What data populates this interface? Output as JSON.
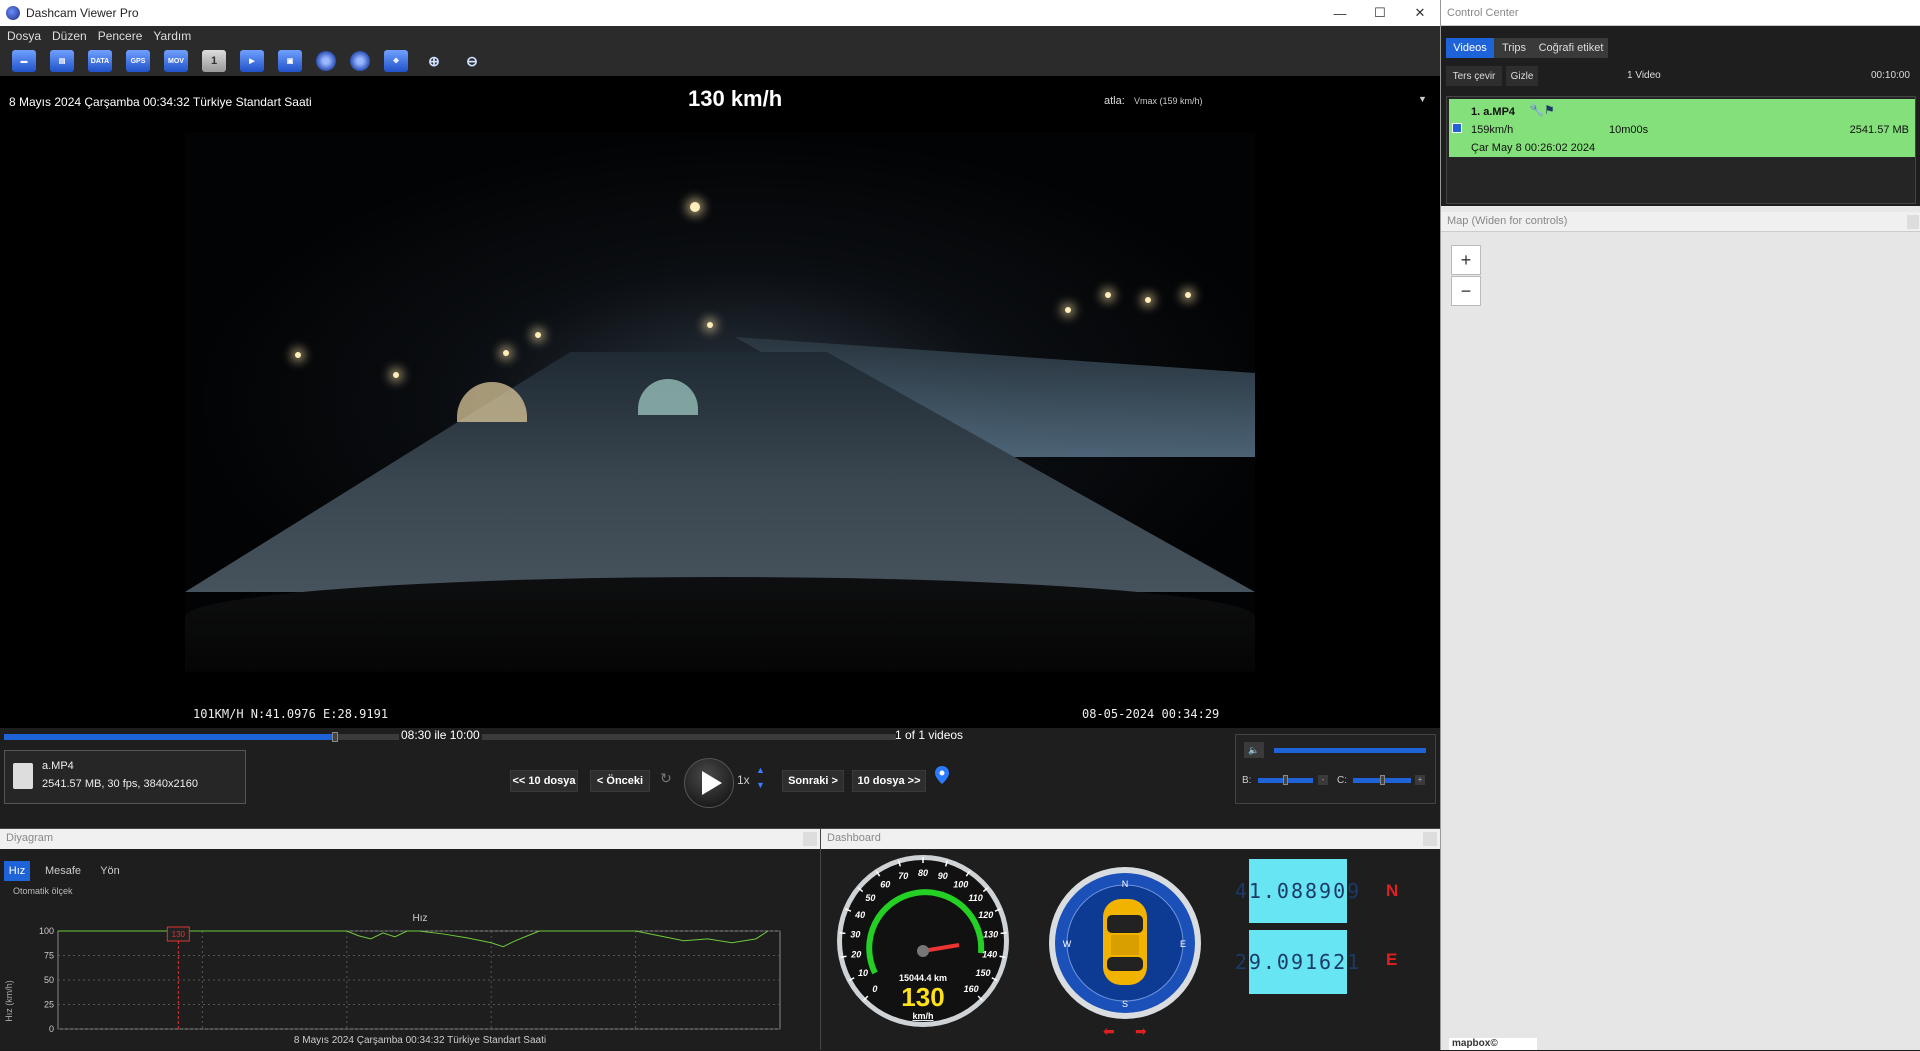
{
  "window": {
    "title": "Dashcam Viewer Pro",
    "minimize": "—",
    "maximize": "☐",
    "close": "✕"
  },
  "menu": [
    "Dosya",
    "Düzen",
    "Pencere",
    "Yardım"
  ],
  "toolbar": {
    "buttons": [
      "open-folder",
      "open-files",
      "DATA",
      "GPS",
      "MOV",
      "1",
      "export-clip",
      "lock",
      "previous-frame",
      "next-frame",
      "fullscreen",
      "zoom-in",
      "zoom-out"
    ],
    "data_label": "DATA",
    "gps_label": "GPS",
    "mov_label": "MOV",
    "one_label": "1"
  },
  "video": {
    "datetime": "8 Mayıs 2024 Çarşamba 00:34:32 Türkiye Standart Saati",
    "speed": "130 km/h",
    "skip_label": "atla:",
    "skip_value": "Vmax (159 km/h)",
    "overlay_gps": "101KM/H N:41.0976 E:28.9191",
    "overlay_time": "08-05-2024 00:34:29"
  },
  "playback": {
    "progress": 0.37,
    "segment_label": "08:30 ile 10:00",
    "videos_count": "1 of 1 videos",
    "file_name": "a.MP4",
    "file_meta": "2541.57 MB, 30 fps, 3840x2160",
    "back10": "<< 10 dosya",
    "prev": "< Önceki",
    "next": "Sonraki >",
    "fwd10": "10 dosya >>",
    "rate": "1x",
    "brightness_label": "B:",
    "contrast_label": "C:",
    "minus": "-",
    "plus": "+"
  },
  "diagram": {
    "title": "Diyagram",
    "tabs": [
      "Hız",
      "Mesafe",
      "Yön"
    ],
    "auto_scale": "Otomatik ölçek",
    "chart_title": "Hız",
    "y_label": "Hız (km/h)",
    "x_label": "8 Mayıs 2024 Çarşamba 00:34:32 Türkiye Standart Saati",
    "marker_value": "130"
  },
  "chart_data": {
    "type": "line",
    "title": "Hız",
    "xlabel": "8 Mayıs 2024 Çarşamba 00:34:32 Türkiye Standart Saati",
    "ylabel": "Hız (km/h)",
    "ylim": [
      0,
      100
    ],
    "yticks": [
      0,
      25,
      50,
      75,
      100
    ],
    "grid": true,
    "series": [
      {
        "color": "#6ec93a",
        "x": [
          0,
          40,
          80,
          120,
          160,
          200,
          240,
          250,
          260,
          270,
          280,
          290,
          300,
          320,
          340,
          360,
          370,
          380,
          390,
          400,
          480,
          500,
          520,
          540,
          560,
          580,
          590
        ],
        "values": [
          100,
          100,
          100,
          100,
          100,
          100,
          100,
          95,
          92,
          98,
          94,
          100,
          100,
          97,
          93,
          88,
          84,
          90,
          95,
          100,
          100,
          95,
          90,
          92,
          88,
          92,
          100
        ]
      }
    ],
    "marker": {
      "x": 100,
      "label": "130"
    }
  },
  "dashboard": {
    "title": "Dashboard",
    "speed": "130",
    "speed_unit": "km/h",
    "odometer": "15044.4 km",
    "gauge_ticks": [
      "0",
      "10",
      "20",
      "30",
      "40",
      "50",
      "60",
      "70",
      "80",
      "90",
      "100",
      "110",
      "120",
      "130",
      "140",
      "150",
      "160"
    ],
    "compass": [
      "N",
      "E",
      "S",
      "W"
    ],
    "latitude": "41.088909",
    "lat_dir": "N",
    "longitude": "29.091621",
    "lon_dir": "E"
  },
  "control_center": {
    "title": "Control Center",
    "tabs": [
      "Videos",
      "Trips",
      "Coğrafi etiket"
    ],
    "reverse": "Ters çevir",
    "hide": "Gizle",
    "video_count": "1 Video",
    "total_duration": "00:10:00",
    "video_row": {
      "title": "1. a.MP4",
      "max_speed": "159km/h",
      "length": "10m00s",
      "size": "2541.57 MB",
      "date": "Çar May 8 00:26:02 2024"
    },
    "map_title": "Map (Widen for controls)",
    "zoom_in": "+",
    "zoom_out": "−",
    "attribution": "mapbox©"
  }
}
